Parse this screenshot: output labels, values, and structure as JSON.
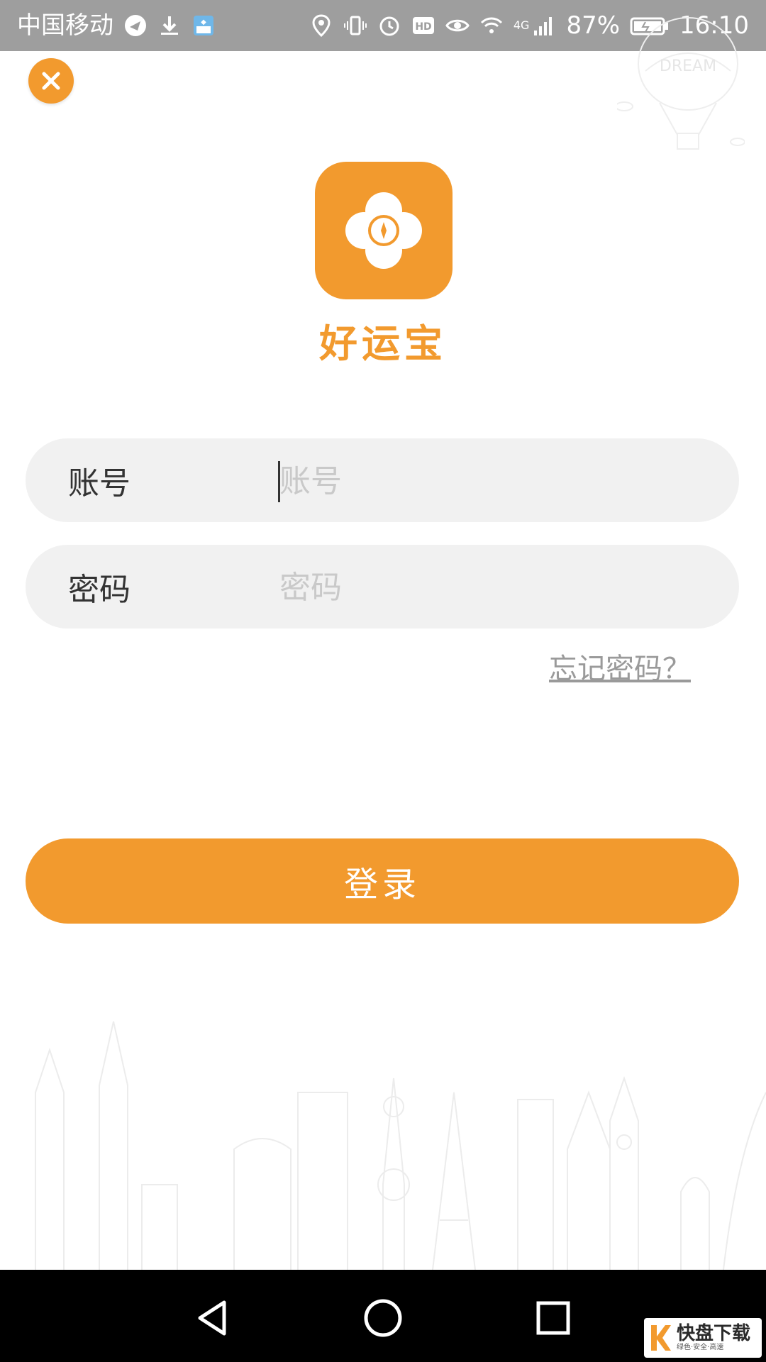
{
  "status_bar": {
    "carrier": "中国移动",
    "network": "4G",
    "battery": "87%",
    "time": "16:10",
    "hd": "HD"
  },
  "app": {
    "name": "好运宝",
    "accent_color": "#f29a2e"
  },
  "form": {
    "account": {
      "label": "账号",
      "placeholder": "账号",
      "value": ""
    },
    "password": {
      "label": "密码",
      "placeholder": "密码",
      "value": ""
    },
    "forgot_label": "忘记密码？",
    "login_label": "登录"
  },
  "decoration": {
    "balloon_text": "DREAM"
  },
  "watermark": {
    "main": "快盘下载",
    "sub": "绿色·安全·高速"
  },
  "icons": [
    "close-icon",
    "back-icon",
    "home-icon",
    "recents-icon",
    "location-icon",
    "vibrate-icon",
    "alarm-icon",
    "eye-icon",
    "wifi-icon",
    "signal-icon",
    "battery-icon",
    "download-icon"
  ]
}
